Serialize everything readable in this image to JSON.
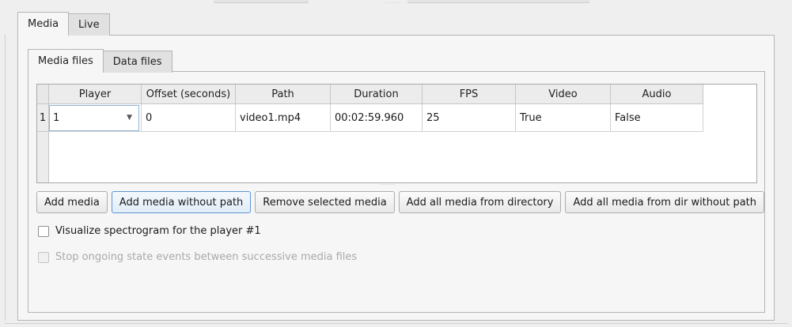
{
  "outer_tabs": [
    {
      "label": "Media",
      "active": true
    },
    {
      "label": "Live",
      "active": false
    }
  ],
  "inner_tabs": [
    {
      "label": "Media files",
      "active": true
    },
    {
      "label": "Data files",
      "active": false
    }
  ],
  "table": {
    "columns": [
      "Player",
      "Offset (seconds)",
      "Path",
      "Duration",
      "FPS",
      "Video",
      "Audio"
    ],
    "rows": [
      {
        "row_number": "1",
        "player": "1",
        "offset": "0",
        "path": "video1.mp4",
        "duration": "00:02:59.960",
        "fps": "25",
        "video": "True",
        "audio": "False"
      }
    ]
  },
  "buttons": {
    "add_media": "Add media",
    "add_media_without_path": "Add media without path",
    "remove_selected_media": "Remove selected media",
    "add_all_from_directory": "Add all media from directory",
    "add_all_from_dir_without_path": "Add all media from dir without path"
  },
  "checkboxes": {
    "visualize_spectrogram": {
      "label": "Visualize spectrogram for the player #1",
      "checked": false,
      "enabled": true
    },
    "stop_ongoing_state_events": {
      "label": "Stop ongoing state events between successive media files",
      "checked": false,
      "enabled": false
    }
  }
}
